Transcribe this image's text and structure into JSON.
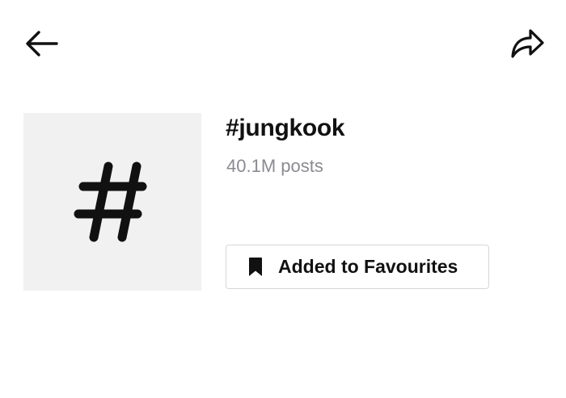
{
  "header": {
    "back_icon": "arrow-left-icon",
    "share_icon": "share-arrow-icon"
  },
  "hashtag": {
    "tile_icon": "hash-icon",
    "tile_glyph": "#",
    "tile_background": "#f1f1f2",
    "title": "#jungkook",
    "post_count": "40.1M posts"
  },
  "favourite_button": {
    "icon": "bookmark-filled-icon",
    "label": "Added to Favourites"
  },
  "colors": {
    "text_primary": "#111111",
    "text_secondary": "#8a8b91",
    "button_border": "#d7d7da"
  }
}
